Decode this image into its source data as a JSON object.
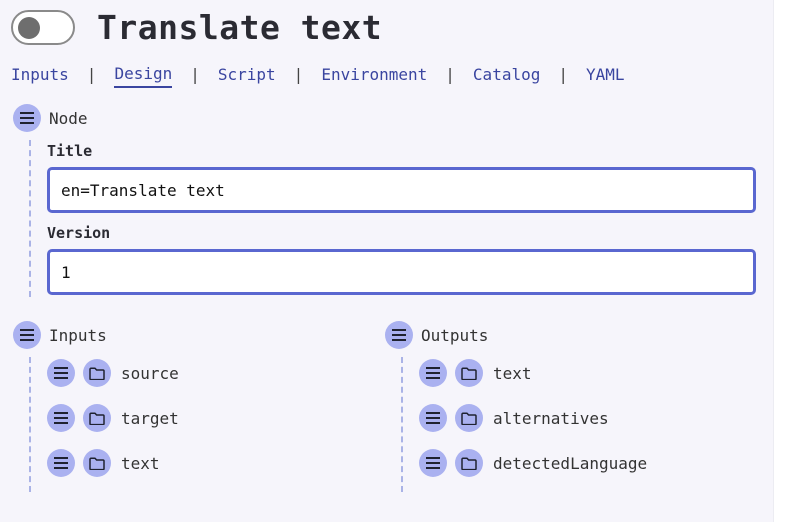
{
  "header": {
    "title": "Translate text"
  },
  "tabs": [
    {
      "label": "Inputs"
    },
    {
      "label": "Design"
    },
    {
      "label": "Script"
    },
    {
      "label": "Environment"
    },
    {
      "label": "Catalog"
    },
    {
      "label": "YAML"
    }
  ],
  "tab_separator": "|",
  "node": {
    "label": "Node",
    "title_label": "Title",
    "title_value": "en=Translate text",
    "version_label": "Version",
    "version_value": "1"
  },
  "inputs": {
    "label": "Inputs",
    "items": [
      {
        "label": "source"
      },
      {
        "label": "target"
      },
      {
        "label": "text"
      }
    ]
  },
  "outputs": {
    "label": "Outputs",
    "items": [
      {
        "label": "text"
      },
      {
        "label": "alternatives"
      },
      {
        "label": "detectedLanguage"
      }
    ]
  },
  "icons": {
    "menu": "hamburger-menu-icon",
    "folder": "folder-icon"
  },
  "colors": {
    "accent": "#3a45a0",
    "button_bg": "#aab1f0",
    "input_border": "#5a67d0"
  }
}
